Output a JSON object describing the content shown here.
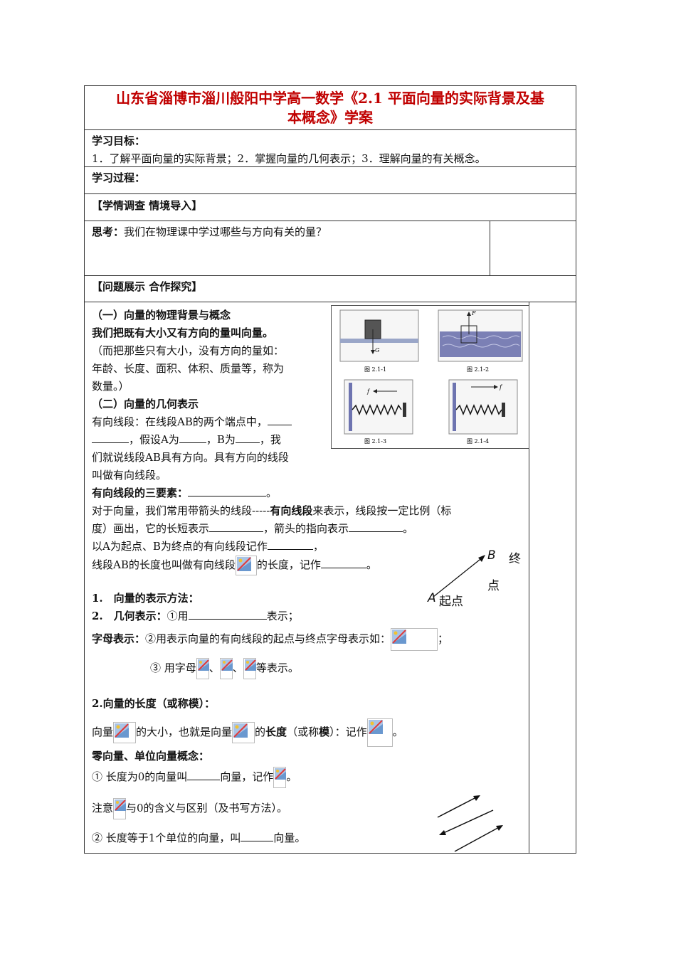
{
  "title": {
    "line1": "山东省淄博市淄川般阳中学高一数学《2.1 平面向量的实际背景及基",
    "line2": "本概念》学案"
  },
  "goals": {
    "heading": "学习目标：",
    "text": "1．了解平面向量的实际背景；2．掌握向量的几何表示；3．理解向量的有关概念。"
  },
  "process": {
    "heading": "学习过程："
  },
  "survey": {
    "heading": "【学情调查 情境导入】"
  },
  "think": {
    "label": "思考：",
    "text": "我们在物理课中学过哪些与方向有关的量？"
  },
  "explore": {
    "heading": "【问题展示 合作探究】"
  },
  "section1": {
    "heading": "（一）向量的物理背景与概念",
    "definition": "我们把既有大小又有方向的量叫向量。",
    "note_l1": "（而把那些只有大小，没有方向的量如：",
    "note_l2": "年龄、长度、面积、体积、质量等，称为",
    "note_l3": "数量。）"
  },
  "section2": {
    "heading": "（二）向量的几何表示",
    "l1": "有向线段：在线段AB的两个端点中，",
    "l2a": "，假设A为",
    "l2b": "，B为",
    "l2c": "，我",
    "l3": "们就说线段AB具有方向。具有方向的线段",
    "l4": "叫做有向线段。",
    "three_label": "有向线段的三要素：",
    "three_end": "。",
    "p1a": "对于向量，我们常用带箭头的线段-----",
    "p1b": "有向线段",
    "p1c": "来表示，线段按一定比例（标",
    "p2a": "度）画出，它的长短表示",
    "p2b": "，箭头的指向表示",
    "p2c": "。",
    "p3a": "以A为起点、B为终点的有向线段记作",
    "p3b": "，",
    "p4a": "线段AB的长度也叫做有向线段",
    "p4b": "的长度，记作",
    "p4c": "。"
  },
  "arrow_fig": {
    "B": "B",
    "end": "终",
    "end2": "点",
    "A": "A",
    "start": "起点"
  },
  "figures": {
    "cap1": "图 2.1-1",
    "cap2": "图 2.1-2",
    "cap3": "图 2.1-3",
    "cap4": "图 2.1-4",
    "G": "G",
    "F": "F",
    "f1": "f",
    "f2": "f"
  },
  "methods": {
    "h1": "1.　向量的表示方法：",
    "h2a": "2.　几何表示：",
    "h2b": "①用",
    "h2c": "表示；",
    "letter_a": "字母表示：",
    "letter_b": "②用表示向量的有向线段的起点与终点字母表示如：",
    "letter_end": "；",
    "l3a": "③ 用字母",
    "sep1": "、",
    "sep2": "、",
    "l3b": "等表示。"
  },
  "length": {
    "heading": "2.向量的长度（或称模）：",
    "a": "向量",
    "b": "的大小，也就是向量",
    "c": "的",
    "d": "长度",
    "e": "（或称",
    "f": "模",
    "g": "）：记作",
    "h": "。"
  },
  "zero": {
    "heading": "零向量、单位向量概念：",
    "l1a": "① 长度为0的向量叫",
    "l1b": "向量，记作",
    "l1c": "。",
    "l2a": "注意",
    "l2b": "与0的含义与区别（及书写方法）。",
    "l3a": "② 长度等于1个单位的向量，叫",
    "l3b": "向量。"
  },
  "colors": {
    "title": "#c00000",
    "border": "#333333"
  }
}
